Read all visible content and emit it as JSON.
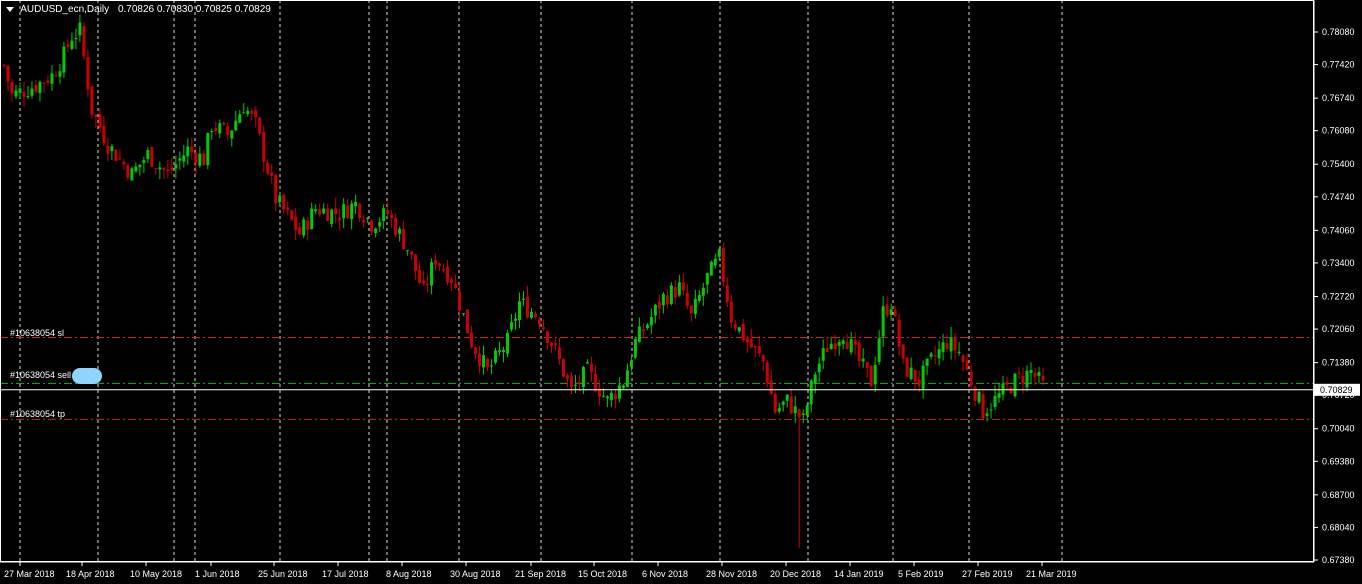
{
  "header": {
    "symbol": "AUDUSD_ecn,Daily",
    "ohlc": "0.70826 0.70830 0.70825 0.70829"
  },
  "current_price_label": "0.70829",
  "order_lines": [
    {
      "label": "#10638054 sl",
      "price": 0.7189,
      "color": "#cc2222",
      "style": "dashdot"
    },
    {
      "label": "#10638054 sell",
      "price": 0.7096,
      "color": "#22aa22",
      "style": "dashdot"
    },
    {
      "label": "#10638054 tp",
      "price": 0.7023,
      "color": "#cc2222",
      "style": "dashdot"
    }
  ],
  "colors": {
    "background": "#000000",
    "bull": "#00cc00",
    "bear": "#cc0000",
    "grid": "#ffffff",
    "text": "#ffffff"
  },
  "chart_data": {
    "type": "candlestick",
    "title": "AUDUSD_ecn,Daily",
    "ylim": [
      0.6738,
      0.7842
    ],
    "y_ticks": [
      "0.78080",
      "0.77420",
      "0.76740",
      "0.76080",
      "0.75400",
      "0.74740",
      "0.74060",
      "0.73400",
      "0.72720",
      "0.72060",
      "0.71380",
      "0.70720",
      "0.70040",
      "0.69380",
      "0.68700",
      "0.68040",
      "0.67380"
    ],
    "x_ticks": [
      "27 Mar 2018",
      "18 Apr 2018",
      "10 May 2018",
      "1 Jun 2018",
      "25 Jun 2018",
      "17 Jul 2018",
      "8 Aug 2018",
      "30 Aug 2018",
      "21 Sep 2018",
      "15 Oct 2018",
      "6 Nov 2018",
      "28 Nov 2018",
      "20 Dec 2018",
      "14 Jan 2019",
      "5 Feb 2019",
      "27 Feb 2019",
      "21 Mar 2019"
    ],
    "grid": true,
    "path_points": [
      [
        0,
        0.774
      ],
      [
        2,
        0.768
      ],
      [
        8,
        0.77
      ],
      [
        12,
        0.772
      ],
      [
        15,
        0.776
      ],
      [
        17,
        0.78
      ],
      [
        19,
        0.781
      ],
      [
        22,
        0.765
      ],
      [
        26,
        0.758
      ],
      [
        32,
        0.752
      ],
      [
        36,
        0.756
      ],
      [
        41,
        0.752
      ],
      [
        46,
        0.757
      ],
      [
        50,
        0.755
      ],
      [
        52,
        0.762
      ],
      [
        56,
        0.76
      ],
      [
        60,
        0.766
      ],
      [
        63,
        0.762
      ],
      [
        68,
        0.747
      ],
      [
        74,
        0.74
      ],
      [
        78,
        0.745
      ],
      [
        84,
        0.744
      ],
      [
        88,
        0.746
      ],
      [
        92,
        0.742
      ],
      [
        96,
        0.744
      ],
      [
        101,
        0.737
      ],
      [
        105,
        0.728
      ],
      [
        108,
        0.735
      ],
      [
        112,
        0.731
      ],
      [
        117,
        0.718
      ],
      [
        121,
        0.712
      ],
      [
        126,
        0.718
      ],
      [
        129,
        0.726
      ],
      [
        134,
        0.723
      ],
      [
        138,
        0.716
      ],
      [
        142,
        0.708
      ],
      [
        146,
        0.712
      ],
      [
        151,
        0.706
      ],
      [
        155,
        0.71
      ],
      [
        158,
        0.718
      ],
      [
        162,
        0.723
      ],
      [
        165,
        0.727
      ],
      [
        169,
        0.729
      ],
      [
        172,
        0.723
      ],
      [
        176,
        0.731
      ],
      [
        179,
        0.735
      ],
      [
        182,
        0.723
      ],
      [
        186,
        0.718
      ],
      [
        190,
        0.714
      ],
      [
        193,
        0.704
      ],
      [
        196,
        0.706
      ],
      [
        200,
        0.702
      ],
      [
        203,
        0.712
      ],
      [
        206,
        0.717
      ],
      [
        210,
        0.72
      ],
      [
        214,
        0.714
      ],
      [
        217,
        0.71
      ],
      [
        220,
        0.724
      ],
      [
        222,
        0.726
      ],
      [
        225,
        0.713
      ],
      [
        229,
        0.71
      ],
      [
        232,
        0.714
      ],
      [
        236,
        0.718
      ],
      [
        239,
        0.716
      ],
      [
        242,
        0.71
      ],
      [
        245,
        0.704
      ],
      [
        249,
        0.707
      ],
      [
        253,
        0.71
      ],
      [
        257,
        0.712
      ],
      [
        260,
        0.709
      ]
    ],
    "flash_crash": {
      "index": 199,
      "low": 0.6762
    }
  }
}
